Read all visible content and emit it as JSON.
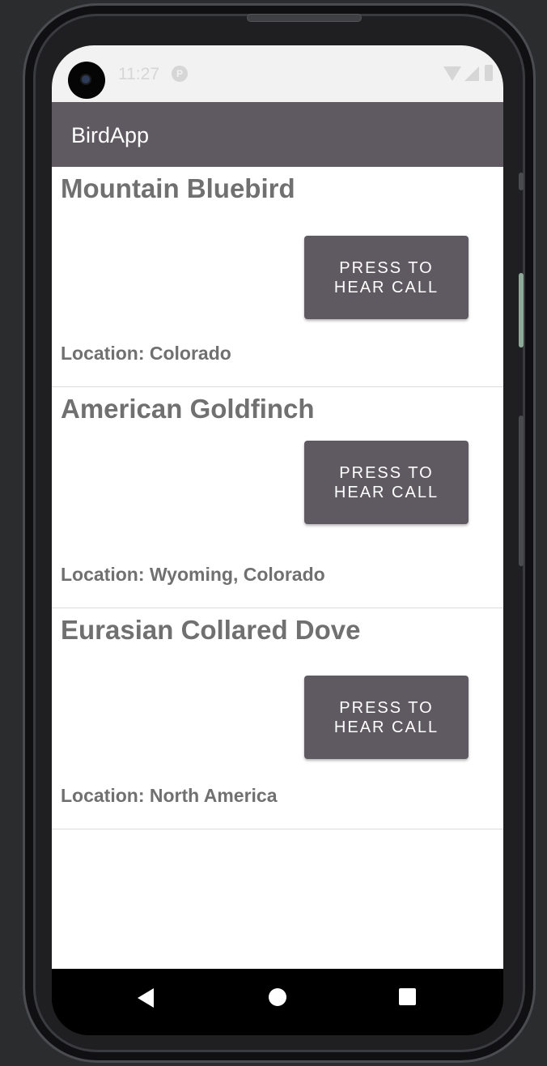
{
  "status_bar": {
    "time": "11:27",
    "notification_icon": "google-play-icon",
    "notification_glyph": "P",
    "wifi_icon": "wifi-icon",
    "signal_icon": "cell-signal-icon",
    "battery_icon": "battery-icon"
  },
  "app_bar": {
    "title": "BirdApp",
    "color": "#5f5a61"
  },
  "birds": [
    {
      "name": "Mountain Bluebird",
      "location": "Location: Colorado",
      "button_label": "PRESS TO HEAR CALL"
    },
    {
      "name": "American Goldfinch",
      "location": "Location: Wyoming, Colorado",
      "button_label": "PRESS TO HEAR CALL"
    },
    {
      "name": "Eurasian Collared Dove",
      "location": "Location: North America",
      "button_label": "PRESS TO HEAR CALL"
    }
  ],
  "nav_bar": {
    "back_icon": "back-triangle-icon",
    "home_icon": "home-circle-icon",
    "recents_icon": "recents-square-icon"
  },
  "colors": {
    "button": "#5f5a61",
    "text": "#707070",
    "background": "#ffffff"
  }
}
